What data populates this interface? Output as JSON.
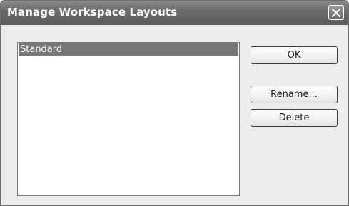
{
  "window": {
    "title": "Manage Workspace Layouts"
  },
  "layouts_list": {
    "items": [
      {
        "label": "Standard",
        "selected": true
      }
    ]
  },
  "buttons": {
    "ok_label": "OK",
    "rename_label": "Rename...",
    "delete_label": "Delete"
  },
  "icons": {
    "close": "close-icon"
  },
  "colors": {
    "titlebar": "#6c6c6c",
    "selection": "#777777",
    "dialog_bg": "#ececec"
  }
}
